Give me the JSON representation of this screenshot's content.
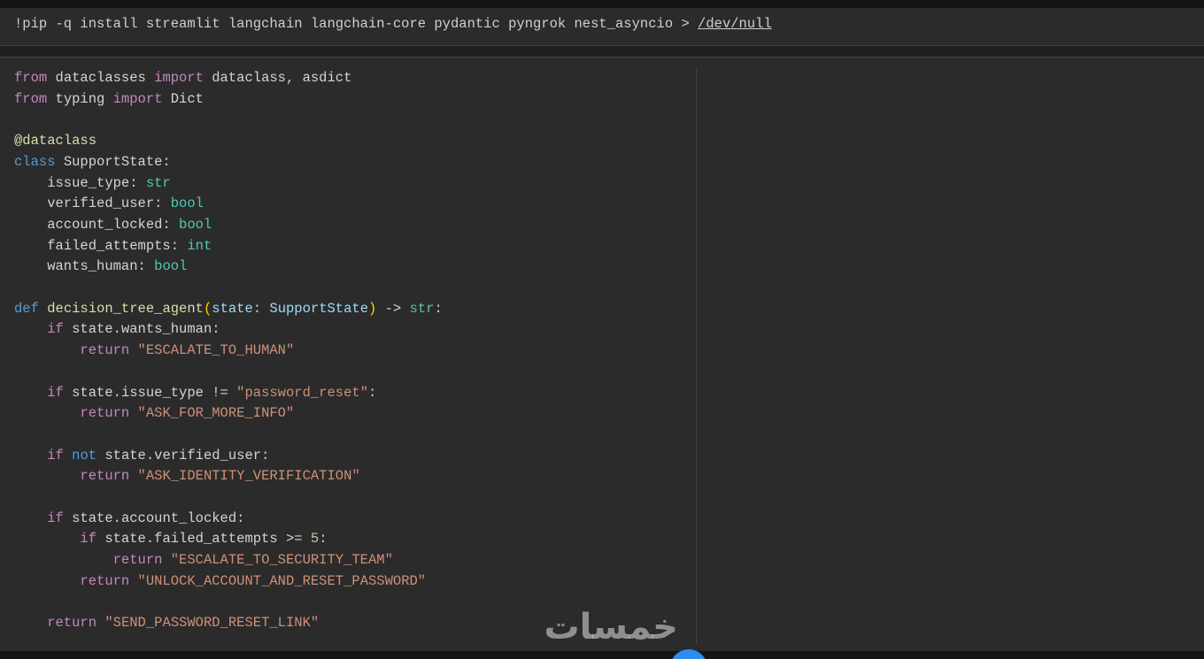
{
  "install_cell": {
    "command": "!pip -q install streamlit langchain langchain-core pydantic pyngrok nest_asyncio ",
    "redirect": "> ",
    "devnull": "/dev/null"
  },
  "code": {
    "l1": [
      "from",
      " dataclasses ",
      "import",
      " dataclass, asdict"
    ],
    "l2": [
      "from",
      " typing ",
      "import",
      " Dict"
    ],
    "l4": "@dataclass",
    "l5": [
      "class",
      " SupportState:"
    ],
    "fields": [
      {
        "name": "    issue_type: ",
        "type": "str"
      },
      {
        "name": "    verified_user: ",
        "type": "bool"
      },
      {
        "name": "    account_locked: ",
        "type": "bool"
      },
      {
        "name": "    failed_attempts: ",
        "type": "int"
      },
      {
        "name": "    wants_human: ",
        "type": "bool"
      }
    ],
    "def_kw": "def",
    "def_name": "decision_tree_agent",
    "def_param": "state",
    "def_colon": ": ",
    "def_type": "SupportState",
    "def_arrow": " -> ",
    "def_ret": "str",
    "if1_cond": " state.wants_human:",
    "ret1": "\"ESCALATE_TO_HUMAN\"",
    "if2_cond": " state.issue_type != ",
    "if2_str": "\"password_reset\"",
    "ret2": "\"ASK_FOR_MORE_INFO\"",
    "not_kw": "not",
    "if3_cond": " state.verified_user:",
    "ret3": "\"ASK_IDENTITY_VERIFICATION\"",
    "if4_cond": " state.account_locked:",
    "if5_cond": " state.failed_attempts >= ",
    "if5_num": "5",
    "ret4": "\"ESCALATE_TO_SECURITY_TEAM\"",
    "ret5": "\"UNLOCK_ACCOUNT_AND_RESET_PASSWORD\"",
    "ret6": "\"SEND_PASSWORD_RESET_LINK\"",
    "if_kw": "if",
    "return_kw": "return"
  },
  "watermark": "خمسات"
}
